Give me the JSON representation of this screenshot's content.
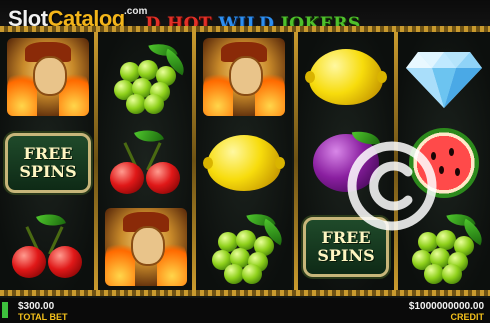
{
  "watermark": {
    "brand_main": "Slot",
    "brand_accent": "Catalog",
    "brand_tld": ".com"
  },
  "game": {
    "title_part_red": "D HOT",
    "title_part_blue": "WILD",
    "title_part_green": "JOKERS"
  },
  "reels": [
    [
      "joker",
      "free-spins",
      "cherries"
    ],
    [
      "grapes",
      "cherries",
      "joker"
    ],
    [
      "joker",
      "lemon",
      "grapes"
    ],
    [
      "lemon",
      "plum",
      "free-spins"
    ],
    [
      "diamond",
      "watermelon",
      "grapes"
    ]
  ],
  "symbols": {
    "free_spins_line1": "FREE",
    "free_spins_line2": "SPINS"
  },
  "overlay": {
    "icon": "copyright-icon"
  },
  "status": {
    "total_bet_value": "$300.00",
    "total_bet_label": "TOTAL BET",
    "credit_value": "$1000000000.00",
    "credit_label": "CREDIT"
  },
  "colors": {
    "title_red": "#e23027",
    "title_blue": "#2d8ff0",
    "title_green": "#4fc02c",
    "label_gold": "#f6c21c",
    "rail_gold": "#c99a2e"
  }
}
